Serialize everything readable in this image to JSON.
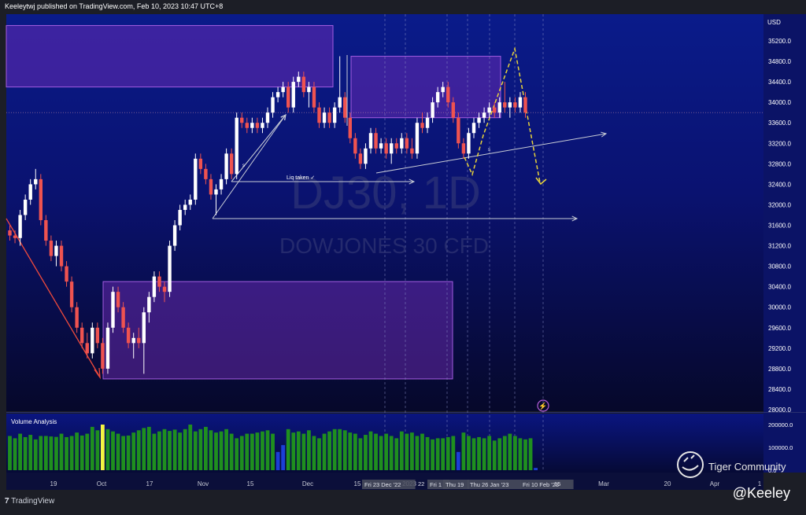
{
  "header": {
    "publisher": "Keeleytwj published on TradingView.com, Feb 10, 2023 10:47 UTC+8"
  },
  "footer": {
    "logo_text": "TradingView",
    "handle": "@Keeley",
    "community": "Tiger Community"
  },
  "chart_data": {
    "type": "candlestick",
    "symbol_watermark": "DJ30, 1D",
    "watermark_subtitle": "DOWJONES 30 CFD",
    "currency": "USD",
    "ylim": [
      28000,
      35500
    ],
    "y_ticks": [
      35200,
      34800,
      34400,
      34000,
      33600,
      33200,
      32800,
      32400,
      32000,
      31600,
      31200,
      30800,
      30400,
      30000,
      29600,
      29200,
      28800,
      28400,
      28000
    ],
    "x_ticks": [
      "19",
      "Oct",
      "17",
      "Nov",
      "15",
      "Dec",
      "15",
      "2023",
      "Mar",
      "20",
      "Apr",
      "1"
    ],
    "date_labels": [
      "Fri 23 Dec '22",
      "Fri 1",
      "Thu 19",
      "Thu 26 Jan '23",
      "Fri 10 Feb '23"
    ],
    "extra_x_labels": [
      "22",
      "15"
    ],
    "annotations": [
      "Liq taken ✓"
    ],
    "volume": {
      "title": "Volume Analysis",
      "y_ticks": [
        200000,
        100000,
        0
      ],
      "y_tick_labels": [
        "200000.0",
        "100000.0",
        "0.0"
      ]
    },
    "candles": [
      {
        "o": 31500,
        "h": 31600,
        "l": 31300,
        "c": 31400
      },
      {
        "o": 31400,
        "h": 31500,
        "l": 31250,
        "c": 31350
      },
      {
        "o": 31350,
        "h": 31900,
        "l": 31200,
        "c": 31800
      },
      {
        "o": 31800,
        "h": 32200,
        "l": 31700,
        "c": 32100
      },
      {
        "o": 32100,
        "h": 32500,
        "l": 32000,
        "c": 32400
      },
      {
        "o": 32400,
        "h": 32700,
        "l": 32300,
        "c": 32500
      },
      {
        "o": 32500,
        "h": 32600,
        "l": 31600,
        "c": 31700
      },
      {
        "o": 31700,
        "h": 31800,
        "l": 31200,
        "c": 31300
      },
      {
        "o": 31300,
        "h": 31400,
        "l": 30900,
        "c": 31000
      },
      {
        "o": 31000,
        "h": 31300,
        "l": 30800,
        "c": 31200
      },
      {
        "o": 31200,
        "h": 31300,
        "l": 30700,
        "c": 30800
      },
      {
        "o": 30800,
        "h": 30900,
        "l": 30400,
        "c": 30500
      },
      {
        "o": 30500,
        "h": 30600,
        "l": 29900,
        "c": 30000
      },
      {
        "o": 30000,
        "h": 30100,
        "l": 29500,
        "c": 29600
      },
      {
        "o": 29600,
        "h": 29700,
        "l": 29200,
        "c": 29300
      },
      {
        "o": 29300,
        "h": 29500,
        "l": 29000,
        "c": 29100
      },
      {
        "o": 29100,
        "h": 29700,
        "l": 29000,
        "c": 29600
      },
      {
        "o": 29600,
        "h": 29700,
        "l": 29200,
        "c": 29300
      },
      {
        "o": 29300,
        "h": 29400,
        "l": 28700,
        "c": 28800
      },
      {
        "o": 28800,
        "h": 29700,
        "l": 28700,
        "c": 29600
      },
      {
        "o": 29600,
        "h": 30400,
        "l": 29500,
        "c": 30300
      },
      {
        "o": 30300,
        "h": 30400,
        "l": 29900,
        "c": 30000
      },
      {
        "o": 30000,
        "h": 30100,
        "l": 29500,
        "c": 29600
      },
      {
        "o": 29600,
        "h": 29700,
        "l": 29200,
        "c": 29300
      },
      {
        "o": 29300,
        "h": 29500,
        "l": 29000,
        "c": 29400
      },
      {
        "o": 29400,
        "h": 29600,
        "l": 29200,
        "c": 29300
      },
      {
        "o": 29300,
        "h": 30000,
        "l": 28700,
        "c": 29900
      },
      {
        "o": 29900,
        "h": 30300,
        "l": 29700,
        "c": 30200
      },
      {
        "o": 30200,
        "h": 30700,
        "l": 30100,
        "c": 30600
      },
      {
        "o": 30600,
        "h": 30700,
        "l": 30300,
        "c": 30400
      },
      {
        "o": 30400,
        "h": 30500,
        "l": 30100,
        "c": 30300
      },
      {
        "o": 30300,
        "h": 31300,
        "l": 30200,
        "c": 31200
      },
      {
        "o": 31200,
        "h": 31700,
        "l": 31100,
        "c": 31600
      },
      {
        "o": 31600,
        "h": 32000,
        "l": 31500,
        "c": 31900
      },
      {
        "o": 31900,
        "h": 32100,
        "l": 31800,
        "c": 32000
      },
      {
        "o": 32000,
        "h": 32200,
        "l": 31900,
        "c": 32100
      },
      {
        "o": 32100,
        "h": 33000,
        "l": 32000,
        "c": 32900
      },
      {
        "o": 32900,
        "h": 33000,
        "l": 32600,
        "c": 32700
      },
      {
        "o": 32700,
        "h": 32800,
        "l": 32400,
        "c": 32500
      },
      {
        "o": 32500,
        "h": 32600,
        "l": 32100,
        "c": 32200
      },
      {
        "o": 32200,
        "h": 32400,
        "l": 31800,
        "c": 32300
      },
      {
        "o": 32300,
        "h": 32600,
        "l": 32200,
        "c": 32500
      },
      {
        "o": 32500,
        "h": 33100,
        "l": 32400,
        "c": 33000
      },
      {
        "o": 33000,
        "h": 33100,
        "l": 32500,
        "c": 32600
      },
      {
        "o": 32600,
        "h": 33800,
        "l": 32500,
        "c": 33700
      },
      {
        "o": 33700,
        "h": 33800,
        "l": 33500,
        "c": 33600
      },
      {
        "o": 33600,
        "h": 33700,
        "l": 33400,
        "c": 33500
      },
      {
        "o": 33500,
        "h": 33700,
        "l": 33400,
        "c": 33600
      },
      {
        "o": 33600,
        "h": 33700,
        "l": 33400,
        "c": 33500
      },
      {
        "o": 33500,
        "h": 33700,
        "l": 33400,
        "c": 33600
      },
      {
        "o": 33600,
        "h": 33900,
        "l": 33500,
        "c": 33800
      },
      {
        "o": 33800,
        "h": 34200,
        "l": 33700,
        "c": 34100
      },
      {
        "o": 34100,
        "h": 34300,
        "l": 34000,
        "c": 34200
      },
      {
        "o": 34200,
        "h": 34400,
        "l": 34100,
        "c": 34300
      },
      {
        "o": 34300,
        "h": 34400,
        "l": 33800,
        "c": 33900
      },
      {
        "o": 33900,
        "h": 34500,
        "l": 33800,
        "c": 34400
      },
      {
        "o": 34400,
        "h": 34600,
        "l": 34300,
        "c": 34500
      },
      {
        "o": 34500,
        "h": 34600,
        "l": 34100,
        "c": 34200
      },
      {
        "o": 34200,
        "h": 34400,
        "l": 33900,
        "c": 34300
      },
      {
        "o": 34300,
        "h": 34400,
        "l": 33800,
        "c": 33900
      },
      {
        "o": 33900,
        "h": 34000,
        "l": 33500,
        "c": 33600
      },
      {
        "o": 33600,
        "h": 33900,
        "l": 33500,
        "c": 33800
      },
      {
        "o": 33800,
        "h": 33900,
        "l": 33500,
        "c": 33600
      },
      {
        "o": 33600,
        "h": 34000,
        "l": 33500,
        "c": 33900
      },
      {
        "o": 33900,
        "h": 34900,
        "l": 33800,
        "c": 34100
      },
      {
        "o": 34100,
        "h": 34200,
        "l": 33600,
        "c": 33700
      },
      {
        "o": 33700,
        "h": 33800,
        "l": 33200,
        "c": 33300
      },
      {
        "o": 33300,
        "h": 33400,
        "l": 32900,
        "c": 33000
      },
      {
        "o": 33000,
        "h": 33100,
        "l": 32700,
        "c": 32800
      },
      {
        "o": 32800,
        "h": 33200,
        "l": 32700,
        "c": 33100
      },
      {
        "o": 33100,
        "h": 33500,
        "l": 33000,
        "c": 33400
      },
      {
        "o": 33400,
        "h": 33500,
        "l": 33000,
        "c": 33100
      },
      {
        "o": 33100,
        "h": 33300,
        "l": 33000,
        "c": 33200
      },
      {
        "o": 33200,
        "h": 33300,
        "l": 32900,
        "c": 33000
      },
      {
        "o": 33000,
        "h": 33300,
        "l": 32800,
        "c": 33200
      },
      {
        "o": 33200,
        "h": 33300,
        "l": 33000,
        "c": 33100
      },
      {
        "o": 33100,
        "h": 33400,
        "l": 33000,
        "c": 33300
      },
      {
        "o": 33300,
        "h": 33400,
        "l": 33000,
        "c": 33100
      },
      {
        "o": 33100,
        "h": 33300,
        "l": 32900,
        "c": 33000
      },
      {
        "o": 33000,
        "h": 33700,
        "l": 32900,
        "c": 33600
      },
      {
        "o": 33600,
        "h": 33800,
        "l": 33400,
        "c": 33500
      },
      {
        "o": 33500,
        "h": 33800,
        "l": 33400,
        "c": 33700
      },
      {
        "o": 33700,
        "h": 34100,
        "l": 33600,
        "c": 34000
      },
      {
        "o": 34000,
        "h": 34300,
        "l": 33900,
        "c": 34200
      },
      {
        "o": 34200,
        "h": 34400,
        "l": 34100,
        "c": 34300
      },
      {
        "o": 34300,
        "h": 34400,
        "l": 33900,
        "c": 34000
      },
      {
        "o": 34000,
        "h": 34100,
        "l": 33600,
        "c": 33700
      },
      {
        "o": 33700,
        "h": 33800,
        "l": 33100,
        "c": 33200
      },
      {
        "o": 33200,
        "h": 33300,
        "l": 32900,
        "c": 33000
      },
      {
        "o": 33000,
        "h": 33500,
        "l": 32900,
        "c": 33400
      },
      {
        "o": 33400,
        "h": 33700,
        "l": 33300,
        "c": 33600
      },
      {
        "o": 33600,
        "h": 33800,
        "l": 33500,
        "c": 33700
      },
      {
        "o": 33700,
        "h": 33900,
        "l": 33600,
        "c": 33800
      },
      {
        "o": 33800,
        "h": 34000,
        "l": 33700,
        "c": 33900
      },
      {
        "o": 33900,
        "h": 34000,
        "l": 33700,
        "c": 33800
      },
      {
        "o": 33800,
        "h": 34100,
        "l": 33700,
        "c": 34000
      },
      {
        "o": 34000,
        "h": 34400,
        "l": 33800,
        "c": 33900
      },
      {
        "o": 33900,
        "h": 34100,
        "l": 33700,
        "c": 34000
      },
      {
        "o": 34000,
        "h": 34100,
        "l": 33800,
        "c": 33900
      },
      {
        "o": 33900,
        "h": 34200,
        "l": 33800,
        "c": 34100
      },
      {
        "o": 34100,
        "h": 34200,
        "l": 33700,
        "c": 33800
      }
    ],
    "volumes": [
      150,
      140,
      160,
      145,
      155,
      135,
      150,
      150,
      148,
      146,
      160,
      145,
      150,
      165,
      152,
      160,
      190,
      175,
      200,
      180,
      170,
      160,
      150,
      152,
      165,
      175,
      185,
      190,
      160,
      170,
      180,
      172,
      178,
      165,
      180,
      200,
      170,
      180,
      190,
      175,
      165,
      170,
      180,
      160,
      140,
      150,
      160,
      160,
      165,
      170,
      175,
      160,
      80,
      110,
      180,
      165,
      170,
      160,
      175,
      150,
      140,
      160,
      170,
      180,
      180,
      175,
      165,
      160,
      140,
      155,
      170,
      160,
      150,
      160,
      150,
      140,
      170,
      160,
      165,
      150,
      160,
      145,
      135,
      140,
      140,
      145,
      150,
      80,
      165,
      150,
      140,
      145,
      140,
      150,
      130,
      140,
      150,
      160,
      150,
      140,
      135,
      140,
      10
    ],
    "volume_bar_colors": {
      "up": "#1f8f1f",
      "down": "#1f8f1f",
      "highlight": "#f5f542",
      "low": "#1b3fd6"
    },
    "highlight_volume_index": 18,
    "low_volume_indices": [
      52,
      53,
      87,
      102
    ],
    "zones": [
      {
        "name": "supply-zone-left",
        "from_price": 34300,
        "to_price": 35500
      },
      {
        "name": "supply-zone-right",
        "from_price": 33700,
        "to_price": 34900
      },
      {
        "name": "demand-zone",
        "from_price": 28600,
        "to_price": 30500
      }
    ],
    "colors": {
      "up": "#ffffff",
      "down": "#ef5350",
      "zone": "#7b2fbe",
      "projection": "#e8d33a",
      "trend": "#ef4a3c",
      "arrow": "#c9cdd6"
    }
  }
}
